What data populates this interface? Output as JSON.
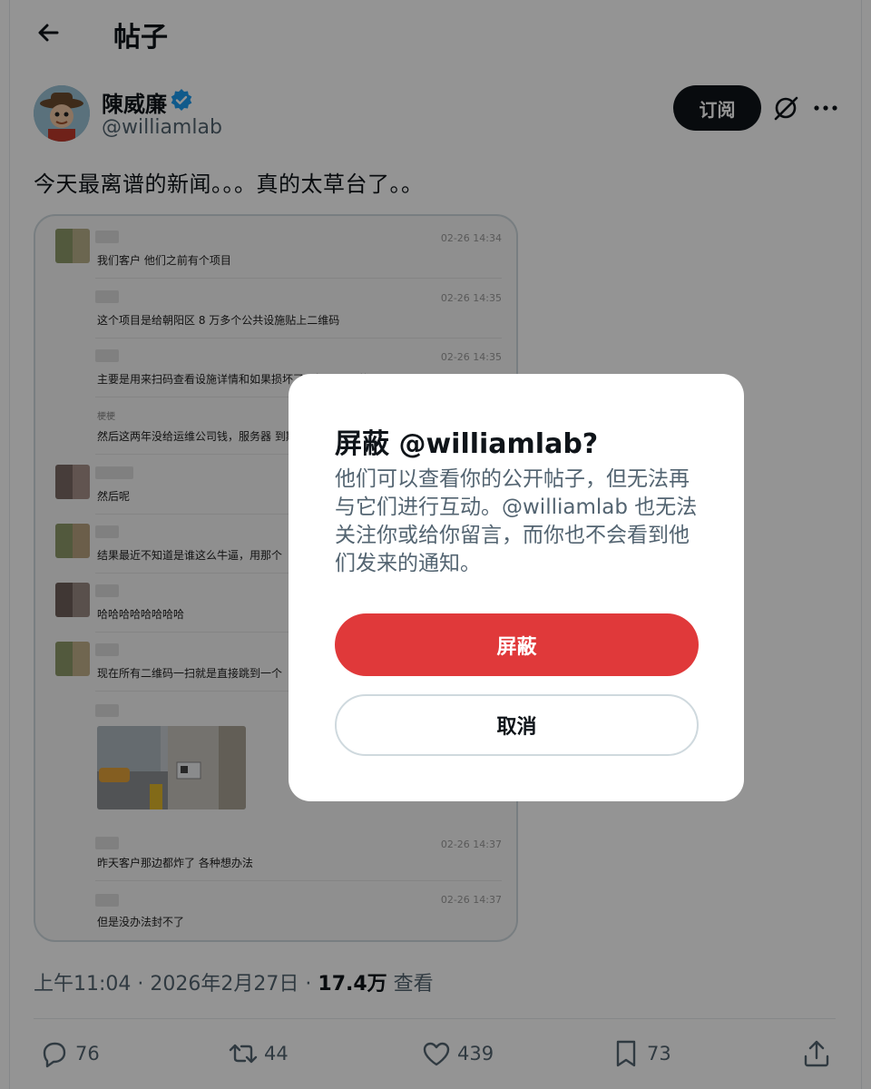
{
  "header": {
    "title": "帖子"
  },
  "author": {
    "name": "陳威廉",
    "handle": "@williamlab"
  },
  "actions": {
    "subscribe_label": "订阅"
  },
  "post": {
    "text": "今天最离谱的新闻。。。真的太草台了。。",
    "time": "上午11:04",
    "date": "2026年2月27日",
    "views_count": "17.4万",
    "views_label": "查看",
    "sep": "·"
  },
  "chat": [
    {
      "time": "02-26 14:34",
      "text": "我们客户 他们之前有个项目"
    },
    {
      "time": "02-26 14:35",
      "text": "这个项目是给朝阳区 8 万多个公共设施贴上二维码"
    },
    {
      "time": "02-26 14:35",
      "text": "主要是用来扫码查看设施详情和如果损坏了上报问题用的"
    },
    {
      "name": "梗梗",
      "text": "然后这两年没给运维公司钱，服务器 到期了"
    },
    {
      "text": "然后呢"
    },
    {
      "text": "结果最近不知道是谁这么牛逼，用那个"
    },
    {
      "text": "哈哈哈哈哈哈哈哈"
    },
    {
      "text": "现在所有二维码一扫就是直接跳到一个"
    },
    {
      "time": "02-26 14:37",
      "text": "昨天客户那边都炸了  各种想办法"
    },
    {
      "time": "02-26 14:37",
      "text": "但是没办法封不了"
    }
  ],
  "stats": {
    "replies": "76",
    "reposts": "44",
    "likes": "439",
    "bookmarks": "73"
  },
  "dialog": {
    "title": "屏蔽 @williamlab?",
    "body": "他们可以查看你的公开帖子，但无法再与它们进行互动。@williamlab 也无法关注你或给你留言，而你也不会看到他们发来的通知。",
    "confirm_label": "屏蔽",
    "cancel_label": "取消"
  },
  "colors": {
    "accent": "#1d9bf0",
    "danger": "#e0393a",
    "overlay": "rgba(0,0,0,0.42)"
  }
}
